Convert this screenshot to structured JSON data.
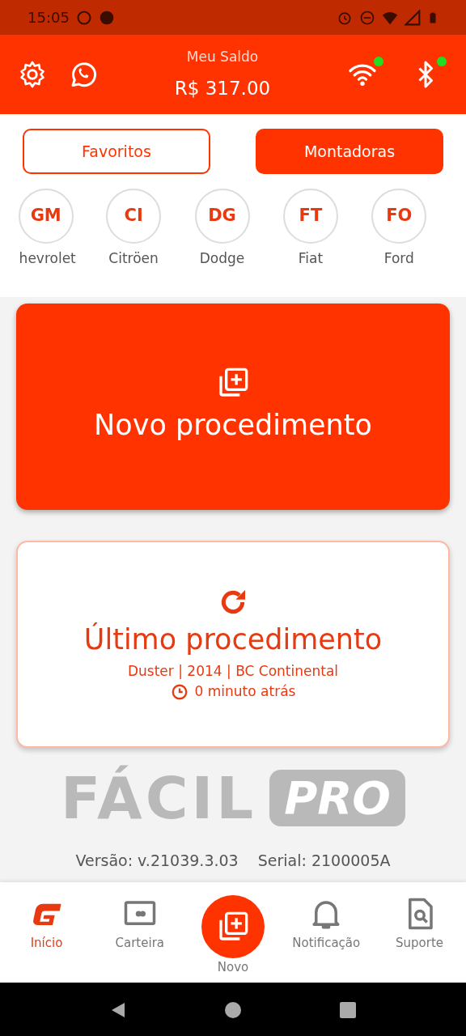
{
  "status_bar": {
    "time": "15:05"
  },
  "header": {
    "balance_label": "Meu Saldo",
    "balance": "R$ 317.00",
    "wifi": {
      "connected": true
    },
    "bluetooth": {
      "connected": true
    }
  },
  "tabs": [
    {
      "label": "Favoritos",
      "selected": false
    },
    {
      "label": "Montadoras",
      "selected": true
    }
  ],
  "brands": [
    {
      "code": "GM",
      "name": "hevrolet"
    },
    {
      "code": "CI",
      "name": "Citröen"
    },
    {
      "code": "DG",
      "name": "Dodge"
    },
    {
      "code": "FT",
      "name": "Fiat"
    },
    {
      "code": "FO",
      "name": "Ford"
    }
  ],
  "new_procedure": {
    "title": "Novo procedimento"
  },
  "last_procedure": {
    "title": "Último procedimento",
    "vehicle": "Duster | 2014 | BC Continental",
    "time": "0 minuto atrás"
  },
  "logo": {
    "word": "FÁCIL",
    "badge": "PRO"
  },
  "footer": {
    "version": "Versão: v.21039.3.03",
    "serial": "Serial: 2100005A"
  },
  "bottom_nav": [
    {
      "kind": "tab",
      "label": "Início",
      "selected": true
    },
    {
      "kind": "tab",
      "label": "Carteira",
      "selected": false
    },
    {
      "kind": "fab",
      "label": "Novo",
      "selected": false
    },
    {
      "kind": "tab",
      "label": "Notificação",
      "selected": false
    },
    {
      "kind": "tab",
      "label": "Suporte",
      "selected": false
    }
  ]
}
